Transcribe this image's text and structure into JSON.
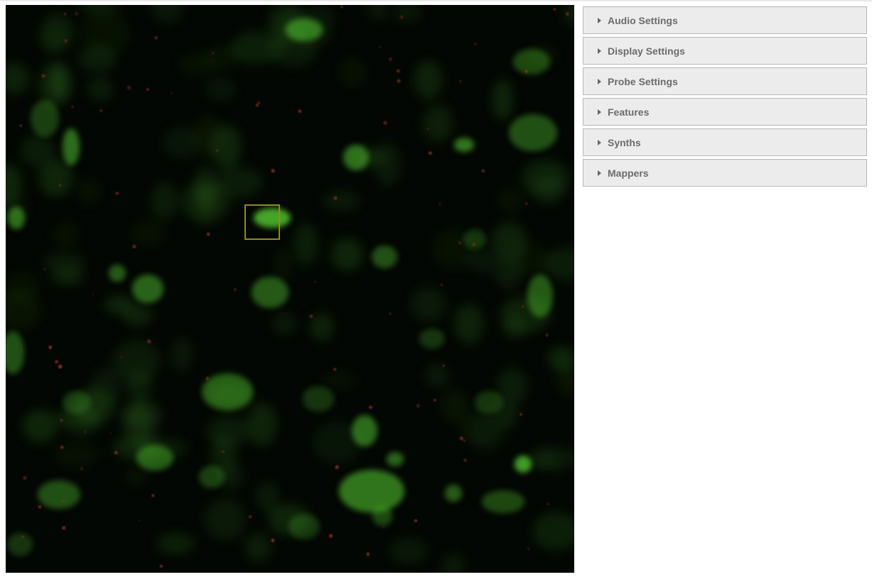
{
  "viewer": {
    "image_description": "fluorescence microscopy image with green cells and red puncta on black background"
  },
  "panel": {
    "sections": [
      {
        "label": "Audio Settings",
        "expanded": false
      },
      {
        "label": "Display Settings",
        "expanded": false
      },
      {
        "label": "Probe Settings",
        "expanded": false
      },
      {
        "label": "Features",
        "expanded": false
      },
      {
        "label": "Synths",
        "expanded": false
      },
      {
        "label": "Mappers",
        "expanded": false
      }
    ]
  },
  "colors": {
    "cell_green": "#4fbf2f",
    "puncta_red": "#b33a2a",
    "probe_outline": "#8f8a1f",
    "section_bg": "#ececec",
    "section_text": "#6c6c6c"
  },
  "icons": {
    "section_toggle": "caret-right-icon"
  }
}
